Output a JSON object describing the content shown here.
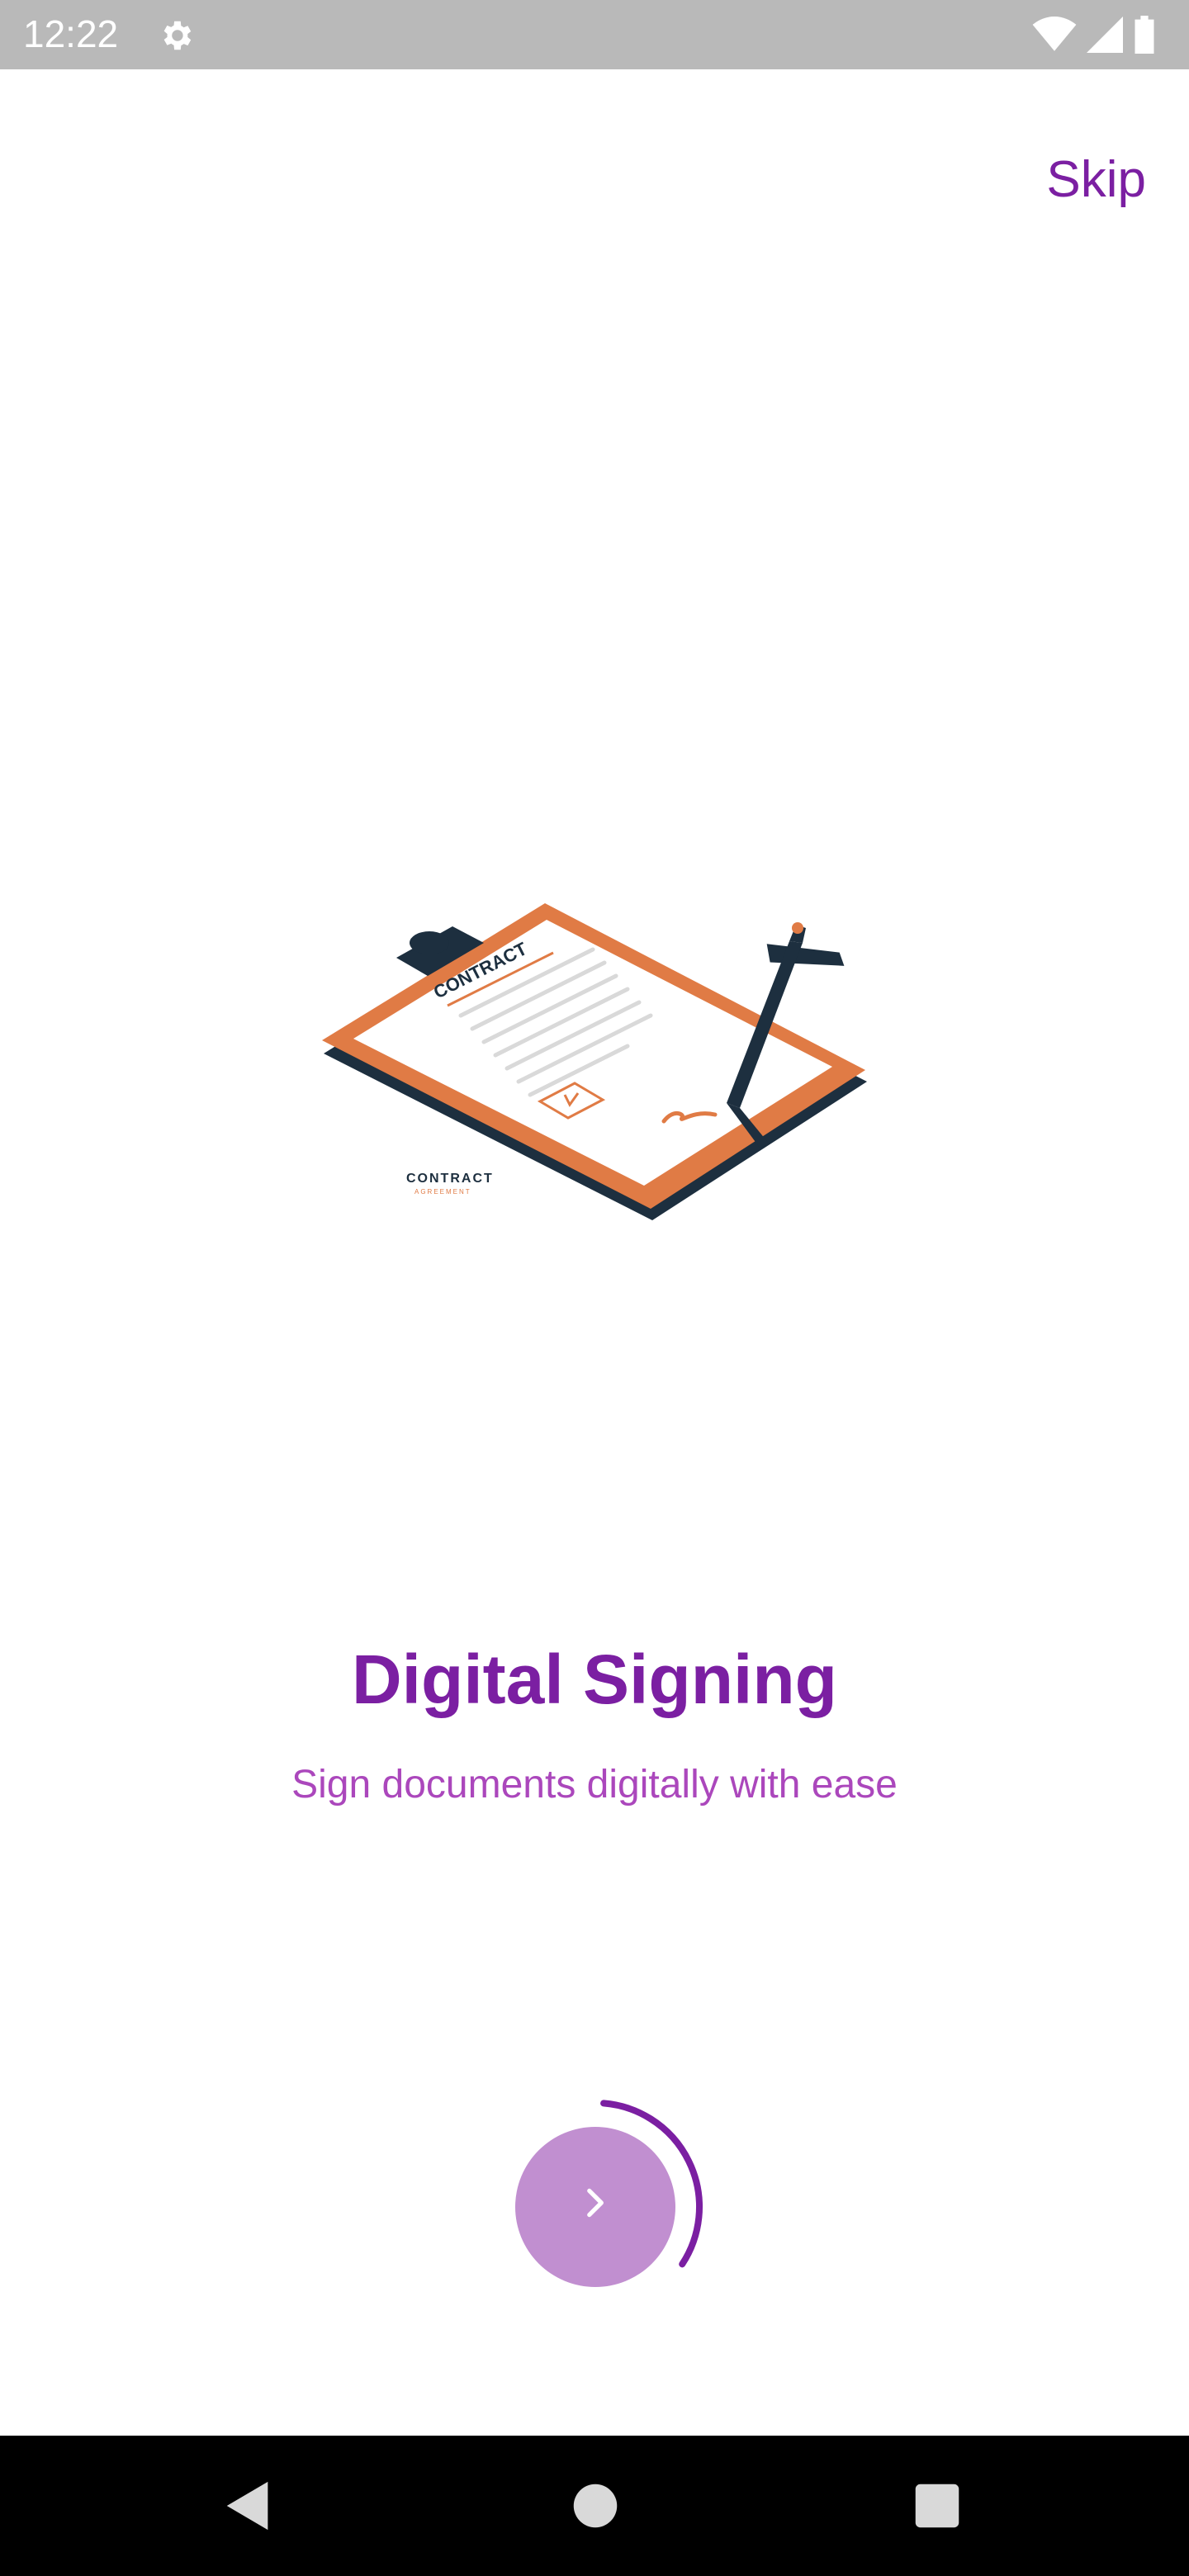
{
  "status_bar": {
    "time": "12:22",
    "icons": [
      "settings-icon",
      "wifi-icon",
      "signal-icon",
      "battery-icon"
    ]
  },
  "header": {
    "skip_label": "Skip"
  },
  "illustration": {
    "icon": "contract-clipboard-illustration",
    "header_text": "CONTRACT",
    "footer_text": "CONTRACT",
    "footer_subtext": "AGREEMENT"
  },
  "content": {
    "title": "Digital Signing",
    "subtitle": "Sign documents digitally with ease"
  },
  "next": {
    "icon": "chevron-right-icon",
    "progress": 0.33
  },
  "nav": {
    "back": "back-icon",
    "home": "home-icon",
    "recent": "recent-apps-icon"
  },
  "colors": {
    "accent": "#7b1fa2",
    "subtitle": "#ab47bc",
    "button": "#c18fd0",
    "status_bar": "#b9b9b9",
    "clipboard": "#e07b45",
    "dark": "#1d2f3f"
  }
}
